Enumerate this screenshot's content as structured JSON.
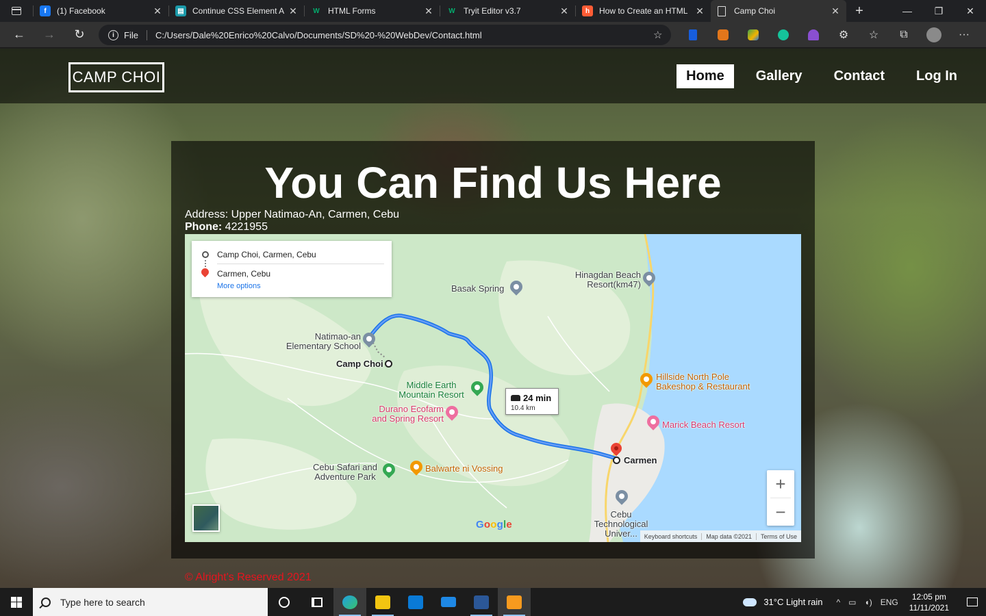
{
  "browser": {
    "tabs": [
      {
        "title": "(1) Facebook",
        "favicon": "facebook-icon",
        "color": "#1877f2",
        "glyph": "f"
      },
      {
        "title": "Continue CSS Element A",
        "favicon": "document-icon",
        "color": "#1b9aaa",
        "glyph": "▤"
      },
      {
        "title": "HTML Forms",
        "favicon": "w3schools-icon",
        "color": "#202124",
        "glyph": "W"
      },
      {
        "title": "Tryit Editor v3.7",
        "favicon": "w3schools-icon",
        "color": "#202124",
        "glyph": "W"
      },
      {
        "title": "How to Create an HTML",
        "favicon": "hubspot-icon",
        "color": "#ff5c35",
        "glyph": "h"
      },
      {
        "title": "Camp Choi",
        "favicon": "page-icon",
        "color": "#323232",
        "glyph": "▯",
        "active": true
      }
    ],
    "new_tab": "+",
    "window_controls": {
      "minimize": "—",
      "maximize": "❐",
      "close": "✕"
    },
    "address": {
      "file_label": "File",
      "url": "C:/Users/Dale%20Enrico%20Calvo/Documents/SD%20-%20WebDev/Contact.html"
    },
    "nav": {
      "back": "←",
      "forward": "→",
      "refresh": "↻"
    },
    "extensions": [
      {
        "name": "bitwarden-icon",
        "color": "#175ddc"
      },
      {
        "name": "metamask-icon",
        "color": "#e2761b"
      },
      {
        "name": "google-drive-icon",
        "color": "#3fa34d"
      },
      {
        "name": "grammarly-icon",
        "color": "#15c39a"
      },
      {
        "name": "wizard-icon",
        "color": "#8a4fd1"
      }
    ],
    "toolbar_glyphs": {
      "extensions": "⚙",
      "favorites": "☆",
      "collections": "⧉",
      "more": "···"
    }
  },
  "site": {
    "logo": "CAMP CHOI",
    "nav": [
      {
        "label": "Home",
        "active": true
      },
      {
        "label": "Gallery",
        "active": false
      },
      {
        "label": "Contact",
        "active": false
      },
      {
        "label": "Log In",
        "active": false
      }
    ],
    "heading": "You Can Find Us Here",
    "address_label": "Address:",
    "address_value": "Upper Natimao-An, Carmen, Cebu",
    "phone_label": "Phone:",
    "phone_value": "4221955",
    "footer": "© Alright's Reserved 2021"
  },
  "map": {
    "directions": {
      "origin": "Camp Choi, Carmen, Cebu",
      "destination": "Carmen, Cebu",
      "more_options": "More options"
    },
    "route": {
      "time": "24 min",
      "distance": "10.4 km"
    },
    "labels": {
      "basak": "Basak Spring",
      "hinagdan1": "Hinagdan Beach",
      "hinagdan2": "Resort(km47)",
      "natimao1": "Natimao-an",
      "natimao2": "Elementary School",
      "campchoi": "Camp Choi",
      "middle1": "Middle Earth",
      "middle2": "Mountain Resort",
      "durano1": "Durano Ecofarm",
      "durano2": "and Spring Resort",
      "hillside1": "Hillside North Pole",
      "hillside2": "Bakeshop & Restaurant",
      "marick": "Marick Beach Resort",
      "carmen": "Carmen",
      "safari1": "Cebu Safari and",
      "safari2": "Adventure Park",
      "balwarte": "Balwarte ni Vossing",
      "ctu1": "Cebu",
      "ctu2": "Technological",
      "ctu3": "Univer..."
    },
    "zoom_in": "+",
    "zoom_out": "−",
    "google": "Google",
    "attribution": [
      "Keyboard shortcuts",
      "Map data ©2021",
      "Terms of Use"
    ]
  },
  "taskbar": {
    "search_placeholder": "Type here to search",
    "apps": [
      {
        "name": "cortana-icon",
        "color": "#ffffff"
      },
      {
        "name": "task-view-icon",
        "color": "#ffffff"
      },
      {
        "name": "edge-icon",
        "color": "#1fa0e3"
      },
      {
        "name": "file-explorer-icon",
        "color": "#f2c511"
      },
      {
        "name": "store-icon",
        "color": "#0a7ad6"
      },
      {
        "name": "mail-icon",
        "color": "#1e88e5"
      },
      {
        "name": "word-icon",
        "color": "#2b5797"
      },
      {
        "name": "sublime-icon",
        "color": "#f79a1e"
      }
    ],
    "weather": "31°C  Light rain",
    "language": "ENG",
    "time": "12:05 pm",
    "date": "11/11/2021"
  }
}
